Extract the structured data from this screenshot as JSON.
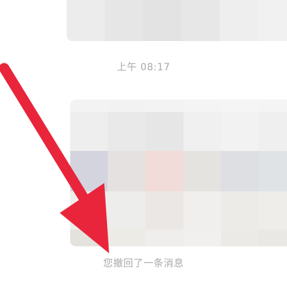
{
  "chat": {
    "timestamp": "上午 08:17",
    "recall_notice": "您撤回了一条消息"
  },
  "images": {
    "top_mosaic": {
      "description_icon": "pixelated-image",
      "tile_colors": [
        "#ececec",
        "#e6e6e6",
        "#e3e3e3",
        "#e7e7e7",
        "#eeeeee",
        "#f1f1f1"
      ]
    },
    "bottom_mosaic": {
      "description_icon": "pixelated-image",
      "tile_colors": [
        [
          "#f3f3f3",
          "#f2f2f2",
          "#f3f3f3",
          "#f4f4f4",
          "#f5f5f5",
          "#f4f4f4"
        ],
        [
          "#eeeeee",
          "#e9e9e9",
          "#e6e6e6",
          "#f0f0f0",
          "#f2f2f2",
          "#efefef"
        ],
        [
          "#d4d4df",
          "#e6e1e1",
          "#f1dcd9",
          "#e5e3e0",
          "#dedfe2",
          "#e0e3e6"
        ],
        [
          "#eeeeea",
          "#ededeb",
          "#eae7e4",
          "#f1efee",
          "#ecebe8",
          "#eeedea"
        ],
        [
          "#e4e2dc",
          "#ecebe6",
          "#f0eeec",
          "#f1f0ee",
          "#ebeae6",
          "#e9e8e4"
        ]
      ]
    }
  },
  "annotation": {
    "arrow_icon": "red-arrow-icon",
    "color": "#e8253a"
  }
}
